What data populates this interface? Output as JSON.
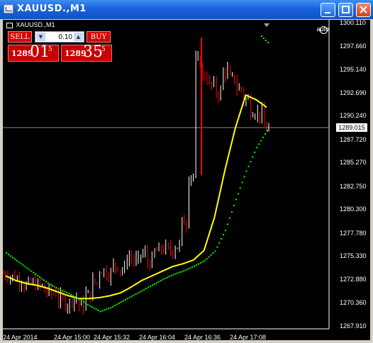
{
  "window": {
    "title": "XAUUSD.,M1",
    "icon": "chart-window-icon"
  },
  "chart_header": {
    "symbol_label": "XAUUSD.,M1",
    "autoscroll_label": "auto"
  },
  "trade_panel": {
    "sell_label": "SELL",
    "buy_label": "BUY",
    "lot_value": "0.10",
    "sell_big": "1289",
    "sell_pips": "01",
    "sell_frac": "5",
    "buy_big": "1289",
    "buy_pips": "35",
    "buy_frac": "5"
  },
  "current_price_label": "1289.015",
  "price_axis": [
    "1300.110",
    "1297.660",
    "1295.140",
    "1292.690",
    "1290.240",
    "1287.720",
    "1285.270",
    "1282.750",
    "1280.300",
    "1277.780",
    "1275.330",
    "1272.880",
    "1270.360",
    "1267.910"
  ],
  "time_axis": [
    "24 Apr 2014",
    "24 Apr 15:00",
    "24 Apr 15:32",
    "24 Apr 16:04",
    "24 Apr 16:36",
    "24 Apr 17:08"
  ],
  "colors": {
    "background": "#000000",
    "candles": "#ffffff",
    "bear": "#ff0000",
    "ma": "#ffff00",
    "green_line": "#00ff00"
  },
  "chart_data": {
    "type": "line",
    "title": "XAUUSD.,M1",
    "xlabel": "",
    "ylabel": "",
    "ylim": [
      1267.91,
      1300.11
    ],
    "x_ticks": [
      "24 Apr 2014",
      "24 Apr 15:00",
      "24 Apr 15:32",
      "24 Apr 16:04",
      "24 Apr 16:36",
      "24 Apr 17:08"
    ],
    "current_price": 1289.015,
    "series": [
      {
        "values": [
          1273.5,
          1273.2,
          1272.9,
          1272.3,
          1272.5,
          1272.2,
          1271.6,
          1271.5,
          1270.8,
          1270.4,
          1270.9,
          1270.2,
          1271.3,
          1272.6,
          1273.9,
          1273.6,
          1274.4,
          1274.0,
          1275.3,
          1274.9,
          1275.6,
          1274.8,
          1275.9,
          1276.2,
          1276.0,
          1276.5,
          1279.0,
          1284.0,
          1296.0,
          1294.5,
          1293.5,
          1292.8,
          1295.0,
          1294.2,
          1293.2,
          1292.0,
          1290.8,
          1290.5,
          1289.1
        ]
      },
      {
        "name": "Moving Average (yellow)",
        "values": [
          1273.3,
          1272.8,
          1272.5,
          1272.3,
          1272.0,
          1271.6,
          1271.2,
          1270.9,
          1270.9,
          1271.0,
          1271.2,
          1271.5,
          1272.1,
          1272.8,
          1273.3,
          1273.8,
          1274.3,
          1274.6,
          1275.0,
          1276.0,
          1279.5,
          1284.5,
          1289.0,
          1292.5,
          1292.0,
          1291.2
        ]
      },
      {
        "name": "Trend Line (green)",
        "values": [
          1275.8,
          1275.0,
          1274.2,
          1273.4,
          1272.6,
          1272.0,
          1271.5,
          1270.9,
          1270.2,
          1269.6,
          1270.0,
          1270.6,
          1271.2,
          1271.8,
          1272.4,
          1273.0,
          1273.5,
          1273.9,
          1274.4,
          1275.0,
          1276.0,
          1278.2,
          1281.5,
          1284.5,
          1287.0,
          1288.8
        ]
      }
    ]
  }
}
